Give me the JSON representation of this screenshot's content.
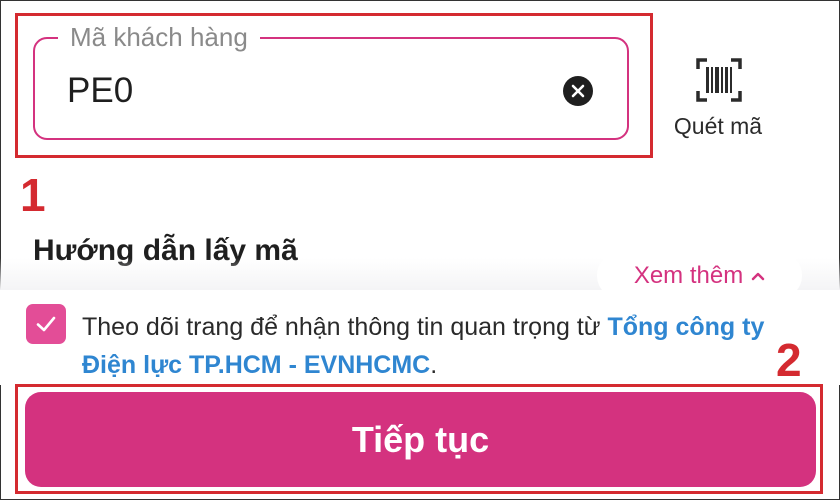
{
  "customer_code": {
    "label": "Mã khách hàng",
    "value": "PE0"
  },
  "scan": {
    "label": "Quét mã"
  },
  "guide": {
    "title": "Hướng dẫn lấy mã",
    "more_label": "Xem thêm"
  },
  "consent": {
    "checked": true,
    "text_before": "Theo dõi trang để nhận thông tin quan trọng từ ",
    "link_text": "Tổng công ty Điện lực TP.HCM - EVNHCMC",
    "text_after": "."
  },
  "continue_label": "Tiếp tục",
  "annotations": {
    "step1": "1",
    "step2": "2"
  },
  "colors": {
    "accent": "#d4327f",
    "checkbox": "#e34d97",
    "link": "#2f86d1",
    "highlight": "#d42a30"
  },
  "icons": {
    "clear": "close-circle-icon",
    "scan": "barcode-scan-icon",
    "chevron": "chevron-up-icon",
    "check": "checkmark-icon"
  }
}
